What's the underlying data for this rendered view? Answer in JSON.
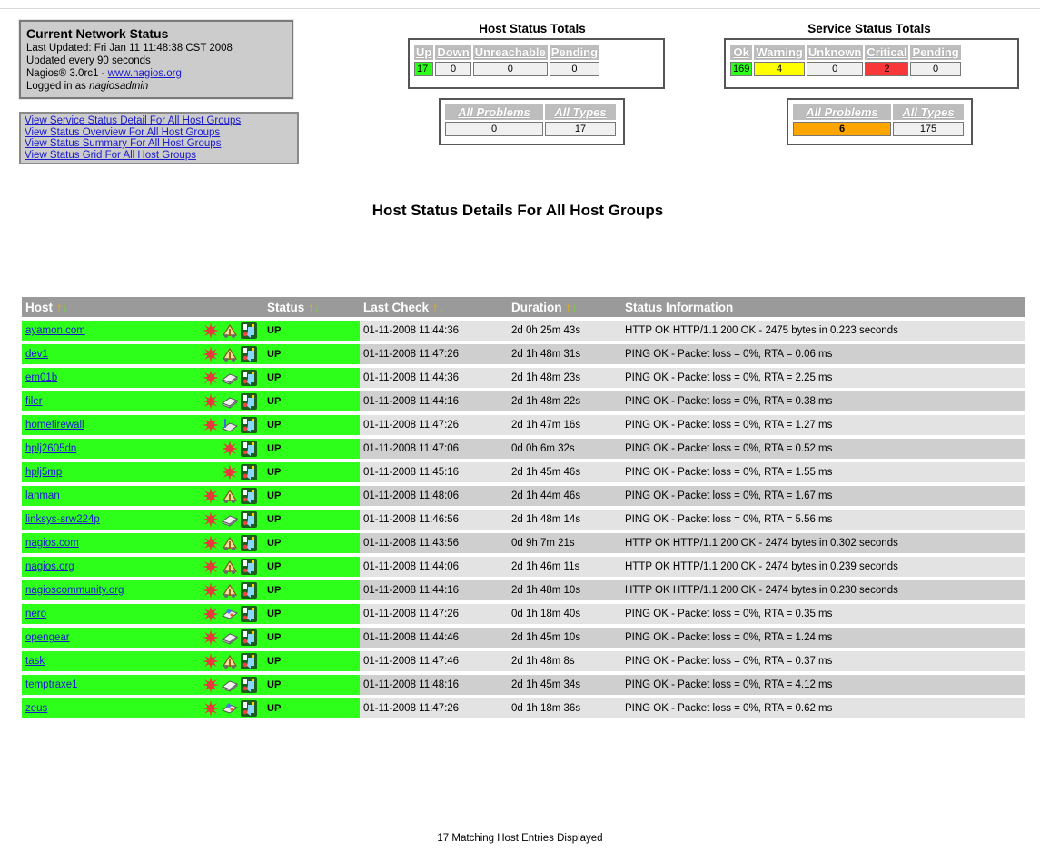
{
  "status_box": {
    "title": "Current Network Status",
    "last_updated": "Last Updated: Fri Jan 11 11:48:38 CST 2008",
    "update_interval": "Updated every 90 seconds",
    "version_prefix": "Nagios® 3.0rc1 - ",
    "version_link": "www.nagios.org",
    "logged_in_prefix": "Logged in as ",
    "logged_in_user": "nagiosadmin"
  },
  "links": [
    "View Service Status Detail For All Host Groups",
    "View Status Overview For All Host Groups",
    "View Status Summary For All Host Groups",
    "View Status Grid For All Host Groups"
  ],
  "host_totals": {
    "title": "Host Status Totals",
    "headers": [
      "Up",
      "Down",
      "Unreachable",
      "Pending"
    ],
    "values": [
      "17",
      "0",
      "0",
      "0"
    ],
    "sub_headers": [
      "All Problems",
      "All Types"
    ],
    "sub_values": [
      "0",
      "17"
    ]
  },
  "service_totals": {
    "title": "Service Status Totals",
    "headers": [
      "Ok",
      "Warning",
      "Unknown",
      "Critical",
      "Pending"
    ],
    "values": [
      "169",
      "4",
      "0",
      "2",
      "0"
    ],
    "sub_headers": [
      "All Problems",
      "All Types"
    ],
    "sub_values": [
      "6",
      "175"
    ]
  },
  "colors": {
    "ok_green": "#2eff1a",
    "warning_yellow": "#ffff00",
    "critical_red": "#f83838",
    "problem_orange": "#ffa500"
  },
  "page_title": "Host Status Details For All Host Groups",
  "columns": [
    "Host",
    "Status",
    "Last Check",
    "Duration",
    "Status Information"
  ],
  "sort_arrows": {
    "up": "↑",
    "down": "↓"
  },
  "hosts": [
    {
      "host": "ayamon.com",
      "status": "UP",
      "last_check": "01-11-2008 11:44:36",
      "duration": "2d 0h 25m 43s",
      "info": "HTTP OK HTTP/1.1 200 OK - 2475 bytes in 0.223 seconds",
      "icons": [
        "notes",
        "service",
        "status-map"
      ]
    },
    {
      "host": "dev1",
      "status": "UP",
      "last_check": "01-11-2008 11:47:26",
      "duration": "2d 1h 48m 31s",
      "info": "PING OK - Packet loss = 0%, RTA = 0.06 ms",
      "icons": [
        "notes",
        "service",
        "status-map"
      ]
    },
    {
      "host": "em01b",
      "status": "UP",
      "last_check": "01-11-2008 11:44:36",
      "duration": "2d 1h 48m 23s",
      "info": "PING OK - Packet loss = 0%, RTA = 2.25 ms",
      "icons": [
        "notes",
        "device",
        "status-map"
      ]
    },
    {
      "host": "filer",
      "status": "UP",
      "last_check": "01-11-2008 11:44:16",
      "duration": "2d 1h 48m 22s",
      "info": "PING OK - Packet loss = 0%, RTA = 0.38 ms",
      "icons": [
        "notes",
        "device",
        "status-map"
      ]
    },
    {
      "host": "homefirewall",
      "status": "UP",
      "last_check": "01-11-2008 11:47:26",
      "duration": "2d 1h 47m 16s",
      "info": "PING OK - Packet loss = 0%, RTA = 1.27 ms",
      "icons": [
        "notes",
        "firewall",
        "status-map"
      ]
    },
    {
      "host": "hplj2605dn",
      "status": "UP",
      "last_check": "01-11-2008 11:47:06",
      "duration": "0d 0h 6m 32s",
      "info": "PING OK - Packet loss = 0%, RTA = 0.52 ms",
      "icons": [
        "notes",
        "status-map"
      ]
    },
    {
      "host": "hplj5mp",
      "status": "UP",
      "last_check": "01-11-2008 11:45:16",
      "duration": "2d 1h 45m 46s",
      "info": "PING OK - Packet loss = 0%, RTA = 1.55 ms",
      "icons": [
        "notes",
        "status-map"
      ]
    },
    {
      "host": "lanman",
      "status": "UP",
      "last_check": "01-11-2008 11:48:06",
      "duration": "2d 1h 44m 46s",
      "info": "PING OK - Packet loss = 0%, RTA = 1.67 ms",
      "icons": [
        "notes",
        "service",
        "status-map"
      ]
    },
    {
      "host": "linksys-srw224p",
      "status": "UP",
      "last_check": "01-11-2008 11:46:56",
      "duration": "2d 1h 48m 14s",
      "info": "PING OK - Packet loss = 0%, RTA = 5.56 ms",
      "icons": [
        "notes",
        "device",
        "status-map"
      ]
    },
    {
      "host": "nagios.com",
      "status": "UP",
      "last_check": "01-11-2008 11:43:56",
      "duration": "0d 9h 7m 21s",
      "info": "HTTP OK HTTP/1.1 200 OK - 2474 bytes in 0.302 seconds",
      "icons": [
        "notes",
        "service",
        "status-map"
      ]
    },
    {
      "host": "nagios.org",
      "status": "UP",
      "last_check": "01-11-2008 11:44:06",
      "duration": "2d 1h 46m 11s",
      "info": "HTTP OK HTTP/1.1 200 OK - 2474 bytes in 0.239 seconds",
      "icons": [
        "notes",
        "service",
        "status-map"
      ]
    },
    {
      "host": "nagioscommunity.org",
      "status": "UP",
      "last_check": "01-11-2008 11:44:16",
      "duration": "2d 1h 48m 10s",
      "info": "HTTP OK HTTP/1.1 200 OK - 2474 bytes in 0.230 seconds",
      "icons": [
        "notes",
        "service",
        "status-map"
      ]
    },
    {
      "host": "nero",
      "status": "UP",
      "last_check": "01-11-2008 11:47:26",
      "duration": "0d 1h 18m 40s",
      "info": "PING OK - Packet loss = 0%, RTA = 0.35 ms",
      "icons": [
        "notes",
        "desktop",
        "status-map"
      ]
    },
    {
      "host": "opengear",
      "status": "UP",
      "last_check": "01-11-2008 11:44:46",
      "duration": "2d 1h 45m 10s",
      "info": "PING OK - Packet loss = 0%, RTA = 1.24 ms",
      "icons": [
        "notes",
        "device",
        "status-map"
      ]
    },
    {
      "host": "task",
      "status": "UP",
      "last_check": "01-11-2008 11:47:46",
      "duration": "2d 1h 48m 8s",
      "info": "PING OK - Packet loss = 0%, RTA = 0.37 ms",
      "icons": [
        "notes",
        "service",
        "status-map"
      ]
    },
    {
      "host": "temptraxe1",
      "status": "UP",
      "last_check": "01-11-2008 11:48:16",
      "duration": "2d 1h 45m 34s",
      "info": "PING OK - Packet loss = 0%, RTA = 4.12 ms",
      "icons": [
        "notes",
        "device",
        "status-map"
      ]
    },
    {
      "host": "zeus",
      "status": "UP",
      "last_check": "01-11-2008 11:47:26",
      "duration": "0d 1h 18m 36s",
      "info": "PING OK - Packet loss = 0%, RTA = 0.62 ms",
      "icons": [
        "notes",
        "desktop",
        "status-map"
      ]
    }
  ],
  "footer": "17 Matching Host Entries Displayed"
}
